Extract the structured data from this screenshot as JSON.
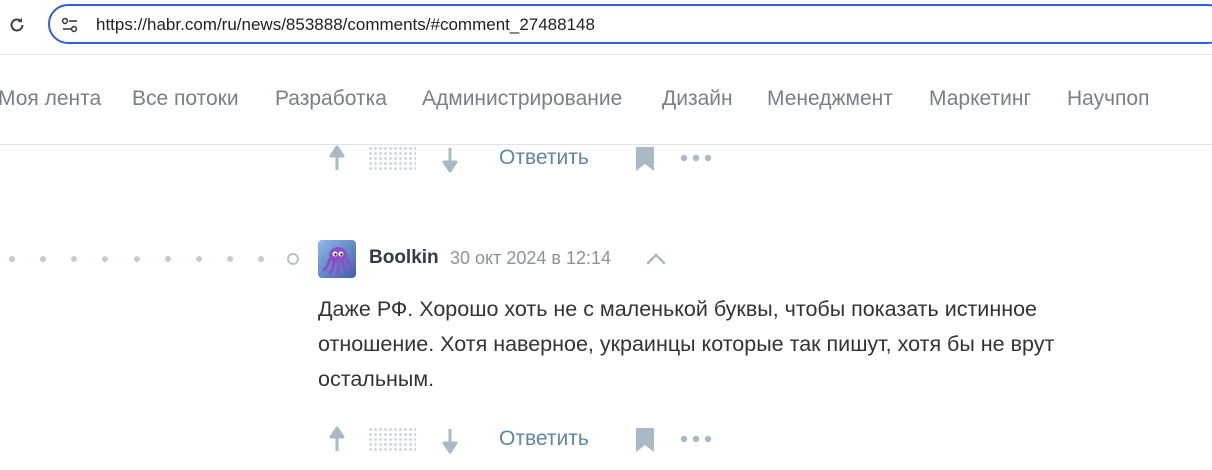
{
  "browser": {
    "url": "https://habr.com/ru/news/853888/comments/#comment_27488148"
  },
  "nav": {
    "items": [
      "Моя лента",
      "Все потоки",
      "Разработка",
      "Администрирование",
      "Дизайн",
      "Менеджмент",
      "Маркетинг",
      "Научпоп"
    ]
  },
  "comment_prev": {
    "reply_label": "Ответить"
  },
  "comment": {
    "author": "Boolkin",
    "timestamp": "30 окт 2024 в 12:14",
    "body_lines": [
      "Даже РФ. Хорошо хоть не с маленькой буквы, чтобы показать истинное",
      "отношение. Хотя наверное, украинцы которые так пишут, хотя бы не врут",
      "остальным."
    ],
    "reply_label": "Ответить"
  },
  "colors": {
    "accent": "#2f5fd0",
    "reply_link": "#5e86a5",
    "icon_gray": "#a9b9c5"
  }
}
